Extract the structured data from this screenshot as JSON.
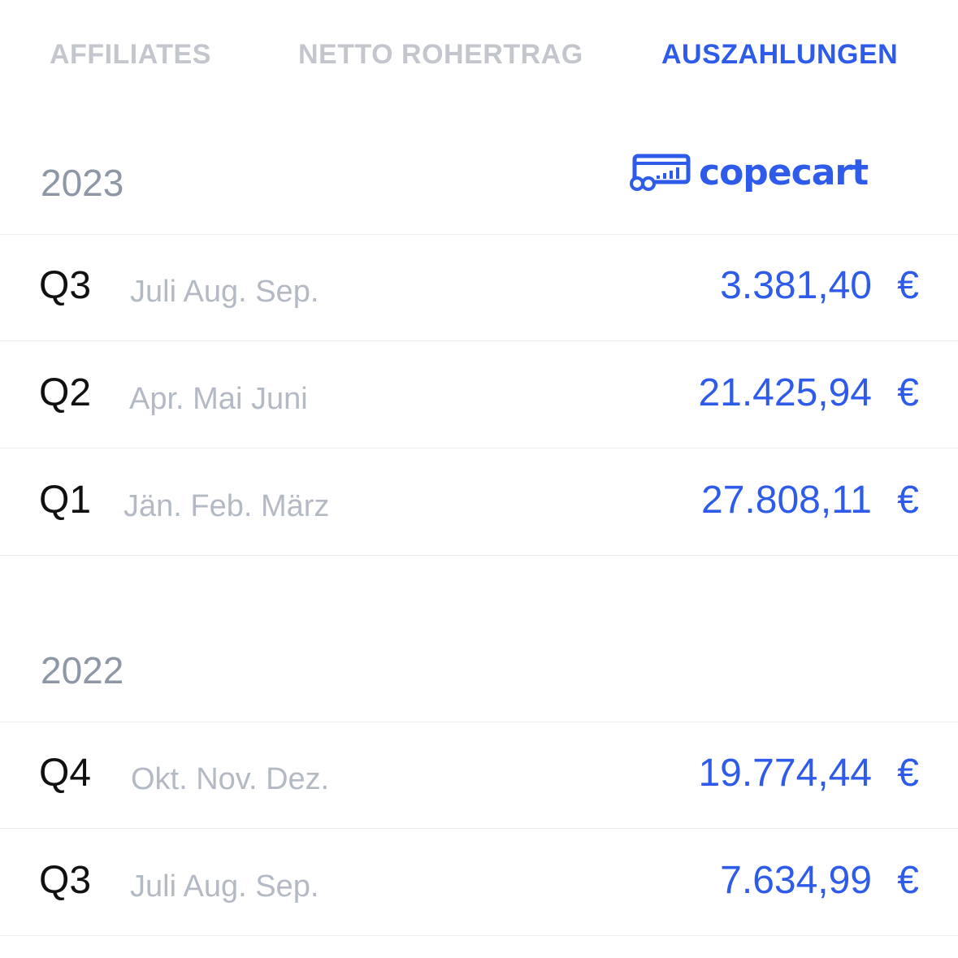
{
  "tabs": [
    {
      "label": "AFFILIATES",
      "active": false
    },
    {
      "label": "NETTO ROHERTRAG",
      "active": false
    },
    {
      "label": "AUSZAHLUNGEN",
      "active": true
    }
  ],
  "brand": {
    "logo_text": "copecart",
    "color": "#2f5bea"
  },
  "years": [
    {
      "year": "2023",
      "rows": [
        {
          "quarter": "Q3",
          "months": "Juli Aug. Sep.",
          "amount": "3.381,40",
          "currency": "€"
        },
        {
          "quarter": "Q2",
          "months": "Apr. Mai Juni",
          "amount": "21.425,94",
          "currency": "€"
        },
        {
          "quarter": "Q1",
          "months": "Jän. Feb. März",
          "amount": "27.808,11",
          "currency": "€"
        }
      ]
    },
    {
      "year": "2022",
      "rows": [
        {
          "quarter": "Q4",
          "months": "Okt. Nov. Dez.",
          "amount": "19.774,44",
          "currency": "€"
        },
        {
          "quarter": "Q3",
          "months": "Juli Aug. Sep.",
          "amount": "7.634,99",
          "currency": "€"
        }
      ]
    }
  ]
}
